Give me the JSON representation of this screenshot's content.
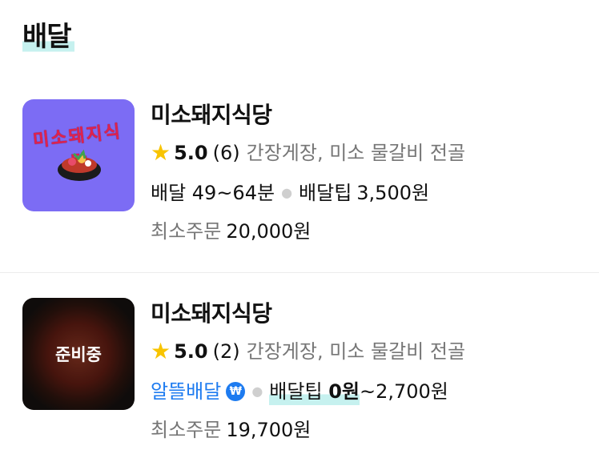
{
  "section": {
    "title": "배달"
  },
  "stores": [
    {
      "name": "미소돼지식당",
      "thumbnail_text": "미소돼지식당",
      "rating": "5.0",
      "review_count": "(6)",
      "menu": "간장게장, 미소 물갈비 전골",
      "delivery_label": "배달 49~64분",
      "tip_label": "배달팁",
      "tip_value": "3,500원",
      "min_order_label": "최소주문",
      "min_order_value": "20,000원"
    },
    {
      "name": "미소돼지식당",
      "status_overlay": "준비중",
      "rating": "5.0",
      "review_count": "(2)",
      "menu": "간장게장, 미소 물갈비 전골",
      "delivery_label": "알뜰배달",
      "badge_symbol": "₩",
      "tip_label": "배달팁",
      "tip_value_bold": "0원",
      "tip_value_rest": "~2,700원",
      "min_order_label": "최소주문",
      "min_order_value": "19,700원"
    }
  ],
  "colors": {
    "accent_blue": "#1d7bf0",
    "star": "#f8c400",
    "highlight": "#c6f1ef",
    "thumb_purple": "#7c6cf4"
  }
}
